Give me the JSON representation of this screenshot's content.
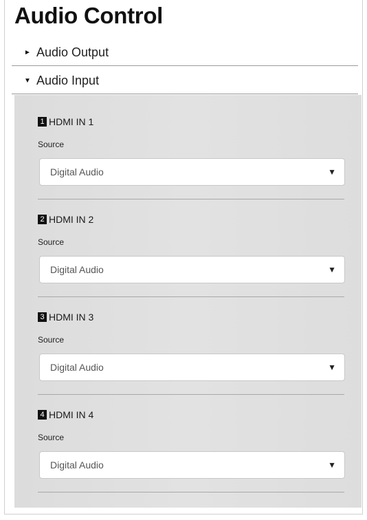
{
  "page": {
    "title": "Audio Control"
  },
  "accordion": {
    "output": {
      "label": "Audio Output",
      "arrow": "►"
    },
    "input": {
      "label": "Audio Input",
      "arrow": "▼"
    }
  },
  "inputs": [
    {
      "number": "1",
      "name": "HDMI IN 1",
      "source_label": "Source",
      "source_value": "Digital Audio"
    },
    {
      "number": "2",
      "name": "HDMI IN 2",
      "source_label": "Source",
      "source_value": "Digital Audio"
    },
    {
      "number": "3",
      "name": "HDMI IN 3",
      "source_label": "Source",
      "source_value": "Digital Audio"
    },
    {
      "number": "4",
      "name": "HDMI IN 4",
      "source_label": "Source",
      "source_value": "Digital Audio"
    }
  ],
  "icons": {
    "dropdown_caret": "▼"
  },
  "colors": {
    "panel_background": "#dddddd",
    "badge_background": "#111111",
    "title_text": "#111111"
  }
}
